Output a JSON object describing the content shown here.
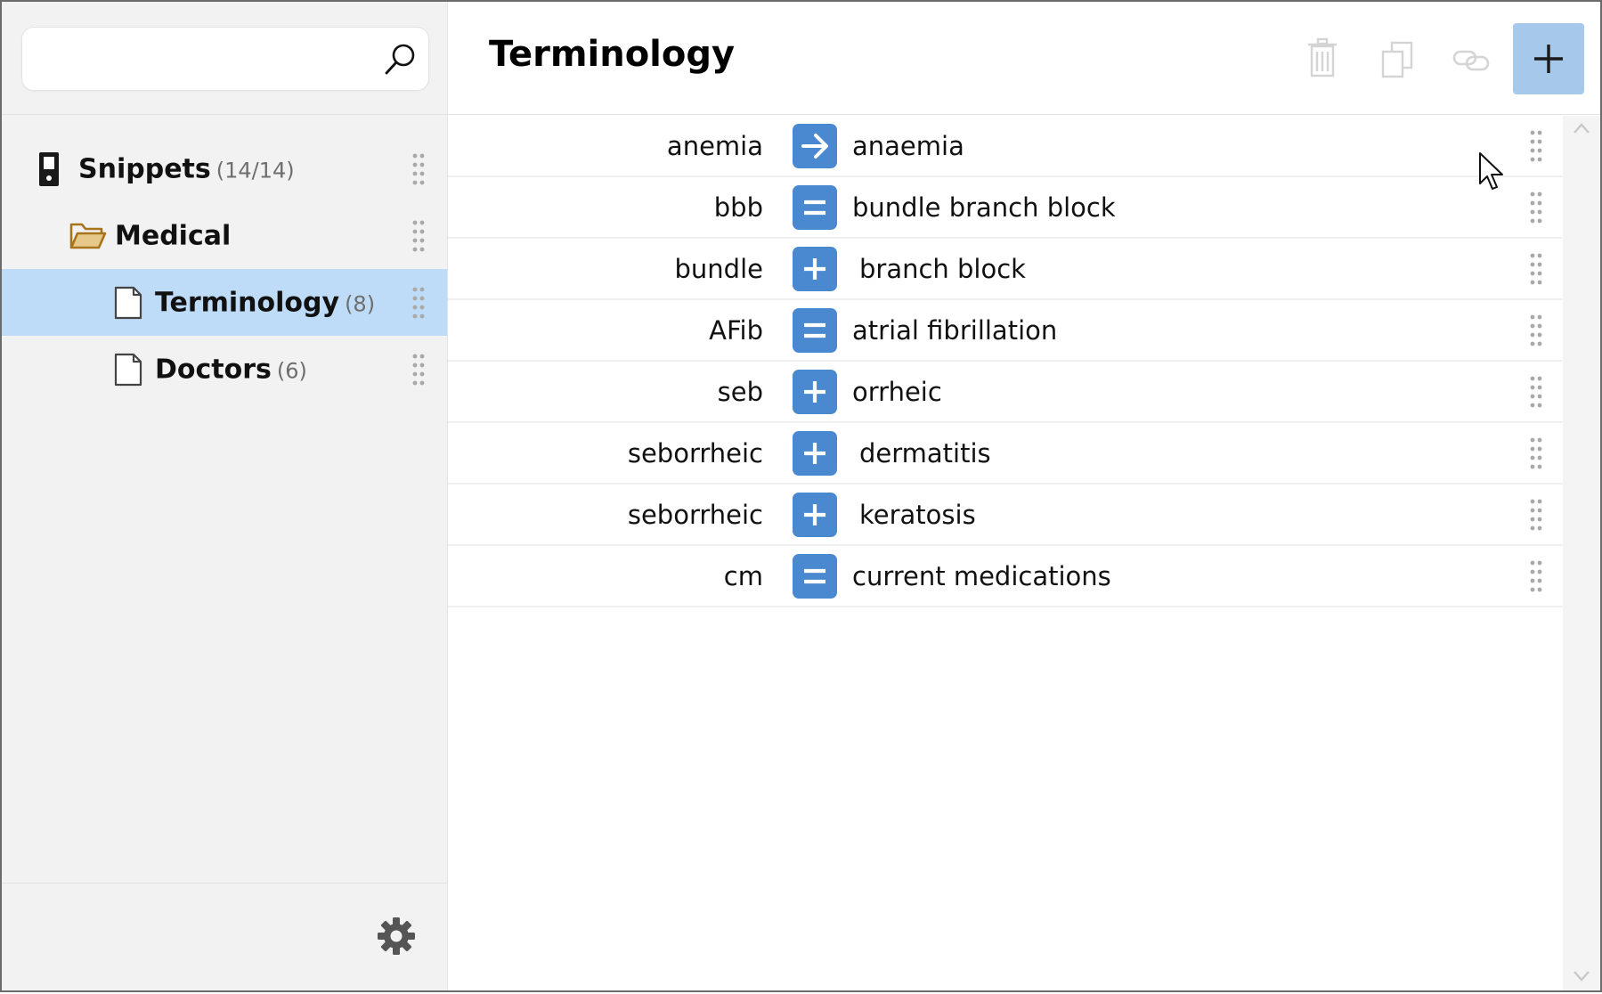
{
  "search": {
    "value": "",
    "placeholder": ""
  },
  "tree": {
    "items": [
      {
        "label": "Snippets",
        "count": "(14/14)",
        "icon": "database-icon"
      },
      {
        "label": "Medical",
        "count": "",
        "icon": "folder-open-icon"
      },
      {
        "label": "Terminology",
        "count": "(8)",
        "icon": "document-icon",
        "selected": true
      },
      {
        "label": "Doctors",
        "count": "(6)",
        "icon": "document-icon"
      }
    ]
  },
  "header": {
    "title": "Terminology",
    "tools": [
      "trash-icon",
      "copy-icon",
      "link-icon",
      "plus-icon"
    ]
  },
  "snippets": [
    {
      "abbr": "anemia",
      "op": "arrow",
      "expansion": "anaemia"
    },
    {
      "abbr": "bbb",
      "op": "equals",
      "expansion": "bundle branch block"
    },
    {
      "abbr": "bundle",
      "op": "plus",
      "expansion": "branch block"
    },
    {
      "abbr": "AFib",
      "op": "equals",
      "expansion": "atrial fibrillation"
    },
    {
      "abbr": "seb",
      "op": "plus",
      "expansion": "orrheic"
    },
    {
      "abbr": "seborrheic",
      "op": "plus",
      "expansion": "dermatitis"
    },
    {
      "abbr": "seborrheic",
      "op": "plus",
      "expansion": "keratosis"
    },
    {
      "abbr": "cm",
      "op": "equals",
      "expansion": "current medications"
    }
  ],
  "colors": {
    "accent": "#4a89d0",
    "selected_bg": "#bedbf7",
    "add_button_bg": "#a6c8ea",
    "folder": "#a8741a"
  }
}
